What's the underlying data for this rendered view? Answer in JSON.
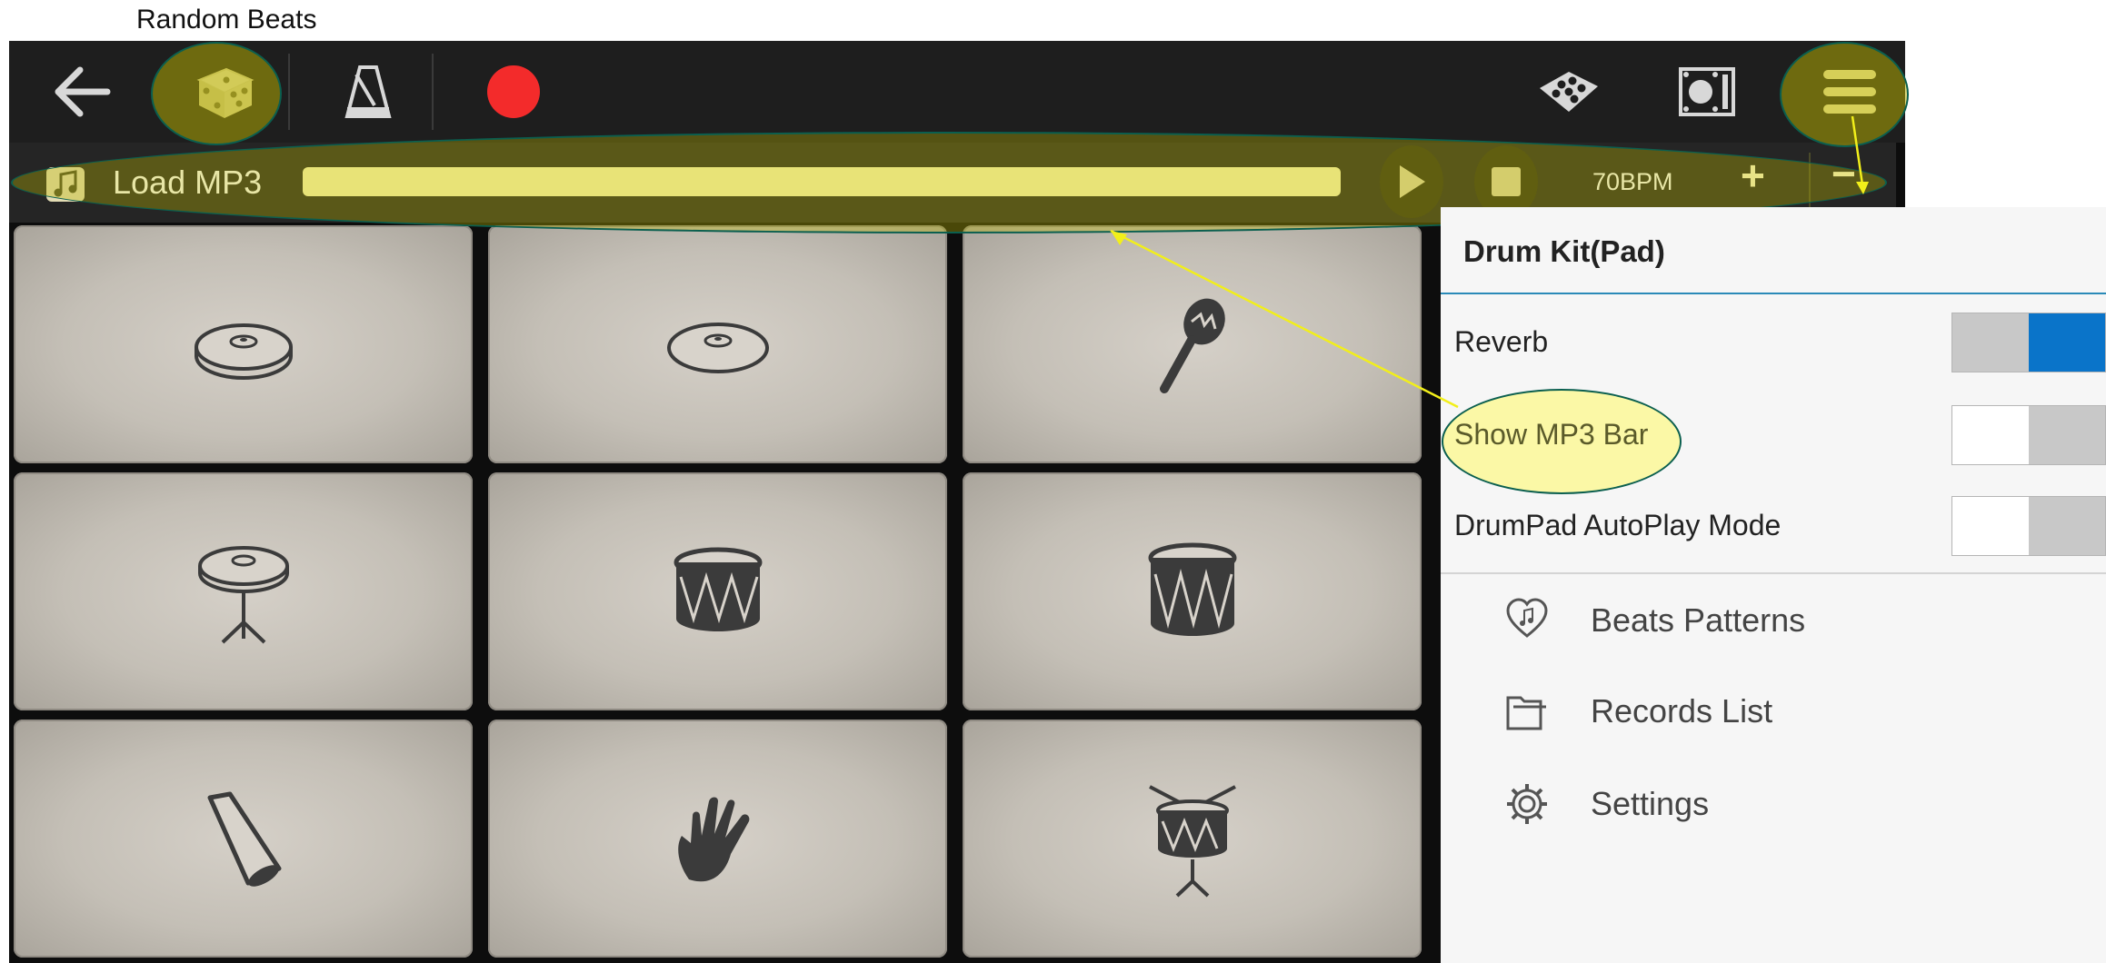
{
  "caption": "Random Beats",
  "toolbar": {
    "back_icon": "back-arrow-icon",
    "dice_icon": "dice-icon",
    "metronome_icon": "metronome-icon",
    "record_icon": "record-icon",
    "drumkit_icon": "drum-kit-icon",
    "pad_icon": "pad-icon",
    "menu_icon": "hamburger-menu-icon"
  },
  "mp3_bar": {
    "load_label": "Load MP3",
    "bpm": "70BPM",
    "plus": "+",
    "minus": "−"
  },
  "pads": [
    {
      "icon": "crash-cymbal-icon"
    },
    {
      "icon": "ride-cymbal-icon"
    },
    {
      "icon": "maracas-icon"
    },
    {
      "icon": "hihat-stand-icon"
    },
    {
      "icon": "snare-drum-icon"
    },
    {
      "icon": "tom-drum-icon"
    },
    {
      "icon": "cowbell-icon"
    },
    {
      "icon": "hand-clap-icon"
    },
    {
      "icon": "marching-drum-icon"
    }
  ],
  "menu": {
    "title": "Drum Kit(Pad)",
    "settings": [
      {
        "label": "Reverb",
        "on": true
      },
      {
        "label": "Show MP3 Bar",
        "on": false
      },
      {
        "label": "DrumPad AutoPlay Mode",
        "on": false
      }
    ],
    "nav": [
      {
        "label": "Beats Patterns",
        "icon": "heart-music-icon"
      },
      {
        "label": "Records List",
        "icon": "folder-icon"
      },
      {
        "label": "Settings",
        "icon": "gear-icon"
      }
    ]
  },
  "colors": {
    "highlight": "#bdb600",
    "record": "#f32b2b",
    "toggle_on": "#0a74c9",
    "accent_line": "#2a8ab8",
    "progress": "#fffbb7"
  }
}
